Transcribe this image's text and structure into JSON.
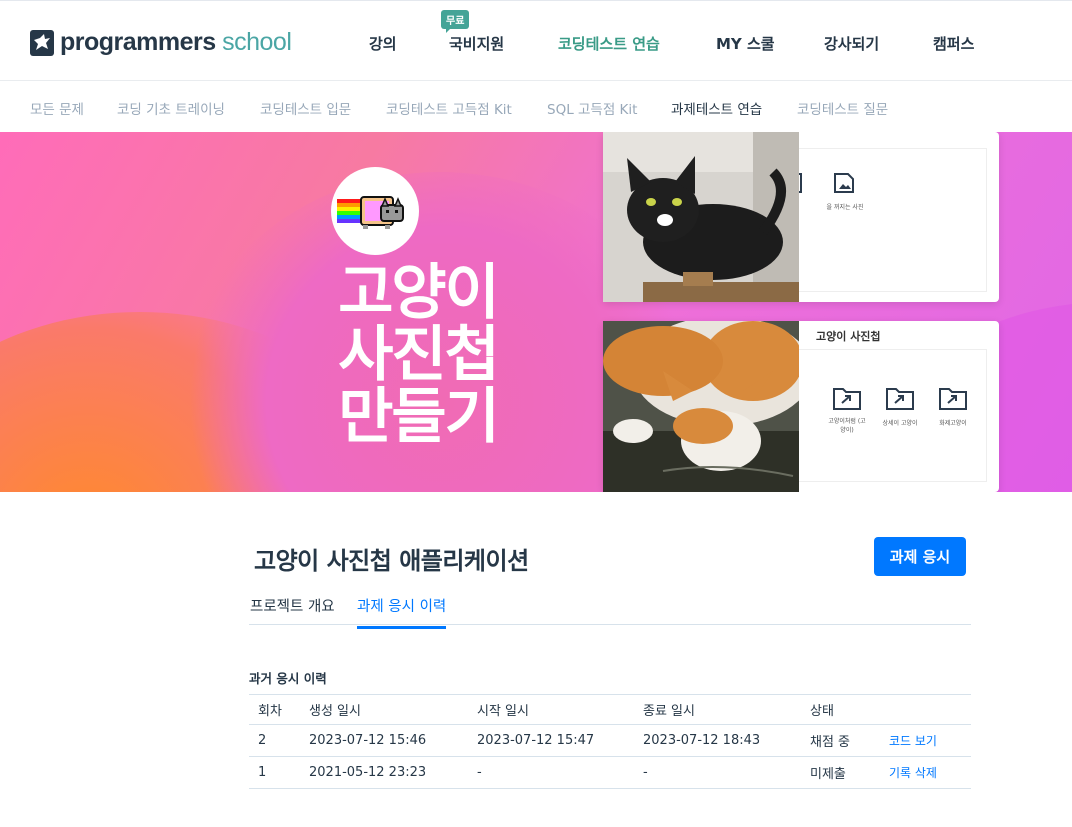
{
  "header": {
    "logo_bold": "programmers",
    "logo_light": "school",
    "nav": [
      {
        "label": "강의"
      },
      {
        "label": "국비지원"
      },
      {
        "label": "코딩테스트 연습"
      },
      {
        "label": "MY 스쿨"
      },
      {
        "label": "강사되기"
      },
      {
        "label": "캠퍼스"
      }
    ],
    "free_badge": "무료",
    "active_nav": "코딩테스트 연습"
  },
  "subnav": {
    "items": [
      {
        "label": "모든 문제"
      },
      {
        "label": "코딩 기초 트레이닝"
      },
      {
        "label": "코딩테스트 입문"
      },
      {
        "label": "코딩테스트 고득점 Kit"
      },
      {
        "label": "SQL 고득점 Kit"
      },
      {
        "label": "과제테스트 연습"
      },
      {
        "label": "코딩테스트 질문"
      }
    ],
    "active": "과제테스트 연습"
  },
  "banner": {
    "title_lines": [
      "고양이",
      "사진첩",
      "만들기"
    ],
    "mock_title": "고양이 사진첩",
    "mock_small_label": "을 꺼지는 사진",
    "folders": [
      {
        "label": "고양이처럼 (고양이)"
      },
      {
        "label": "상세이 고양이"
      },
      {
        "label": "화제고양이"
      }
    ],
    "colors": {
      "pink": "#ff6cb9",
      "orange": "#ff8a2b",
      "purple": "#e067e6"
    }
  },
  "main": {
    "title": "고양이 사진첩 애플리케이션",
    "apply_button": "과제 응시",
    "tabs": [
      {
        "label": "프로젝트 개요"
      },
      {
        "label": "과제 응시 이력"
      }
    ],
    "active_tab": "과제 응시 이력",
    "history_label": "과거 응시 이력",
    "table": {
      "headers": [
        "회차",
        "생성 일시",
        "시작 일시",
        "종료 일시",
        "상태",
        ""
      ],
      "rows": [
        {
          "round": "2",
          "created": "2023-07-12 15:46",
          "started": "2023-07-12 15:47",
          "ended": "2023-07-12 18:43",
          "status": "채점 중",
          "action": "코드 보기"
        },
        {
          "round": "1",
          "created": "2021-05-12 23:23",
          "started": "-",
          "ended": "-",
          "status": "미제출",
          "action": "기록 삭제"
        }
      ]
    },
    "accent_color": "#0078ff"
  }
}
